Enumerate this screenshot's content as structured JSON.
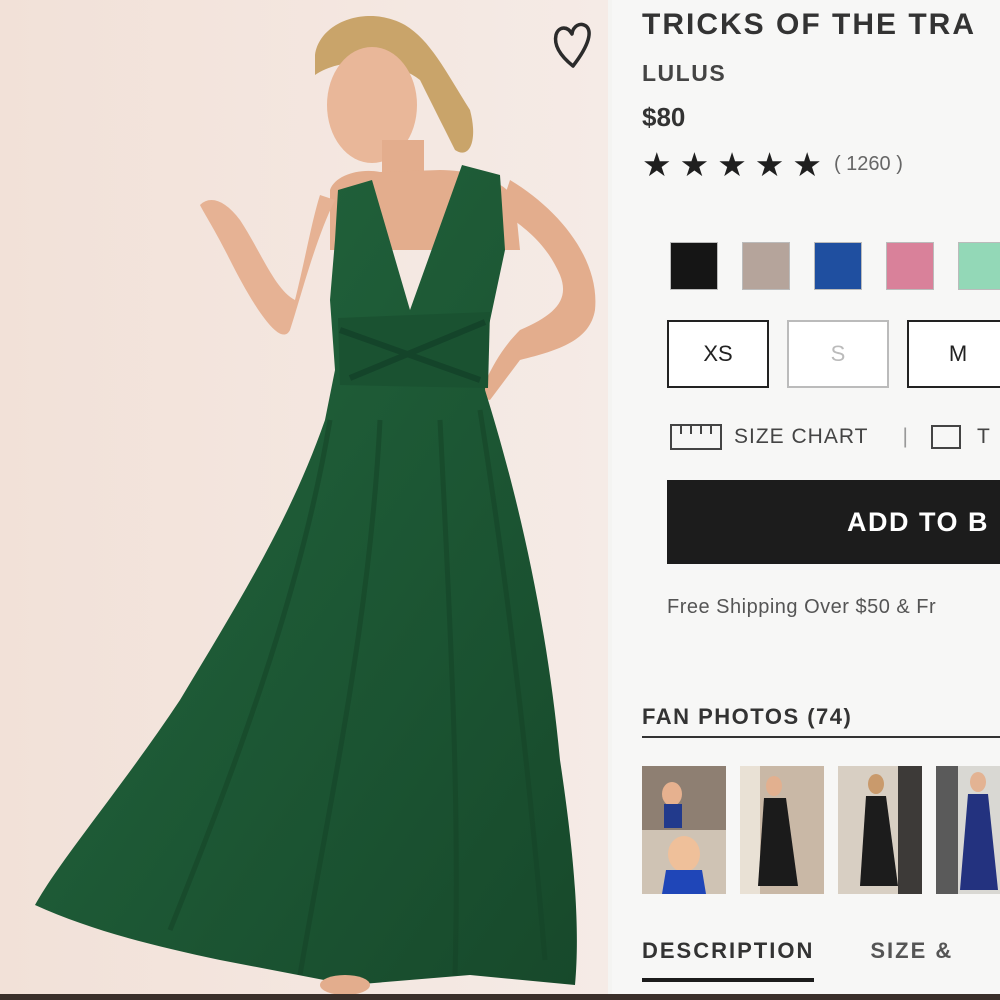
{
  "product": {
    "title": "TRICKS OF THE TRA",
    "brand": "LULUS",
    "price": "$80",
    "rating_stars": 5,
    "review_count": "( 1260 )"
  },
  "icons": {
    "favorite": "heart-icon",
    "star": "star-icon",
    "size_chart": "ruler-icon",
    "questions": "speech-bubble-icon"
  },
  "colors": {
    "swatches": [
      "#151515",
      "#b5a49b",
      "#1f4fa0",
      "#d9819a",
      "#93d8b7"
    ],
    "dress": "#1e5a36",
    "add_button": "#1c1c1c"
  },
  "sizes": [
    {
      "label": "XS",
      "available": true
    },
    {
      "label": "S",
      "available": false
    },
    {
      "label": "M",
      "available": true
    }
  ],
  "size_chart_label": "SIZE CHART",
  "questions_label": "T",
  "add_to_bag_label": "ADD TO B",
  "shipping_text": "Free Shipping Over $50 & Fr",
  "fan_photos": {
    "heading": "FAN PHOTOS (74)",
    "count": 4
  },
  "tabs": [
    {
      "label": "DESCRIPTION",
      "active": true
    },
    {
      "label": "SIZE &",
      "active": false
    }
  ]
}
